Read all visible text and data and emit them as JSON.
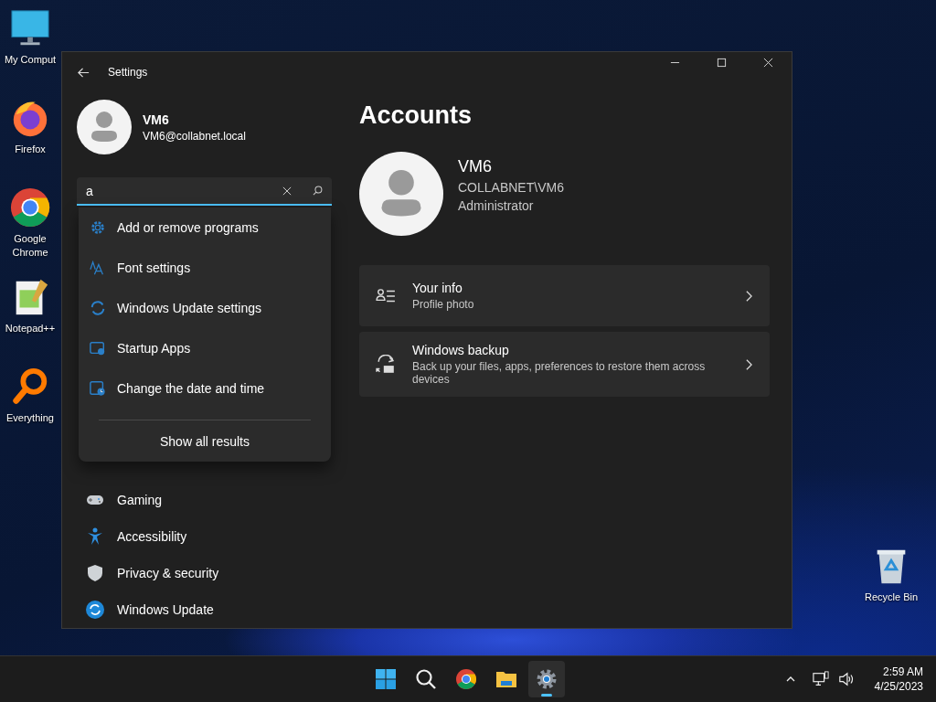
{
  "desktop_icons": [
    {
      "label": "My Comput",
      "kind": "computer"
    },
    {
      "label": "Firefox",
      "kind": "firefox"
    },
    {
      "label": "Google Chrome",
      "kind": "chrome"
    },
    {
      "label": "Notepad++",
      "kind": "notepad"
    },
    {
      "label": "Everything",
      "kind": "everything"
    }
  ],
  "recycle_bin": {
    "label": "Recycle Bin",
    "kind": "recycle"
  },
  "window": {
    "title": "Settings"
  },
  "profile": {
    "name": "VM6",
    "email": "VM6@collabnet.local"
  },
  "search": {
    "value": "a"
  },
  "search_results": [
    {
      "label": "Add or remove programs",
      "kind": "gear"
    },
    {
      "label": "Font settings",
      "kind": "font"
    },
    {
      "label": "Windows Update settings",
      "kind": "update"
    },
    {
      "label": "Startup Apps",
      "kind": "startup"
    },
    {
      "label": "Change the date and time",
      "kind": "clock"
    }
  ],
  "show_all": "Show all results",
  "nav_items": [
    {
      "label": "Gaming",
      "kind": "gaming"
    },
    {
      "label": "Accessibility",
      "kind": "accessibility"
    },
    {
      "label": "Privacy & security",
      "kind": "shield"
    },
    {
      "label": "Windows Update",
      "kind": "update"
    }
  ],
  "page": {
    "title": "Accounts",
    "user": {
      "name": "VM6",
      "domain": "COLLABNET\\VM6",
      "role": "Administrator"
    },
    "cards": [
      {
        "title": "Your info",
        "subtitle": "Profile photo",
        "kind": "info"
      },
      {
        "title": "Windows backup",
        "subtitle": "Back up your files, apps, preferences to restore them across devices",
        "kind": "backup"
      }
    ]
  },
  "taskbar": {
    "apps": [
      {
        "kind": "start",
        "selected": false
      },
      {
        "kind": "search",
        "selected": false
      },
      {
        "kind": "chrome",
        "selected": false
      },
      {
        "kind": "explorer",
        "selected": false
      },
      {
        "kind": "settings",
        "selected": true
      }
    ],
    "time": "2:59 AM",
    "date": "4/25/2023"
  }
}
